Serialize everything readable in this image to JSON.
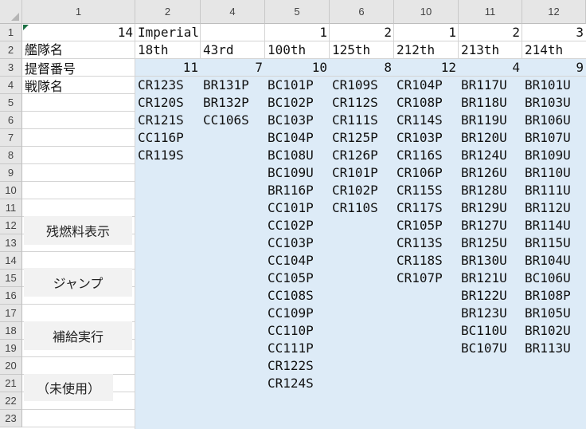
{
  "column_headers": [
    "1",
    "2",
    "4",
    "5",
    "6",
    "10",
    "11",
    "12"
  ],
  "row_headers": [
    "1",
    "2",
    "3",
    "4",
    "5",
    "6",
    "7",
    "8",
    "9",
    "10",
    "11",
    "12",
    "13",
    "14",
    "15",
    "16",
    "17",
    "18",
    "19",
    "20",
    "21",
    "22",
    "23"
  ],
  "row1": {
    "a": "14",
    "b": "Imperial",
    "c": "",
    "d": "1",
    "e": "2",
    "f": "1",
    "g": "2",
    "h": "3"
  },
  "row2": {
    "a": "艦隊名",
    "b": "18th",
    "c": "43rd",
    "d": "100th",
    "e": "125th",
    "f": "212th",
    "g": "213th",
    "h": "214th"
  },
  "row3": {
    "a": "提督番号",
    "b": "11",
    "c": "7",
    "d": "10",
    "e": "8",
    "f": "12",
    "g": "4",
    "h": "9"
  },
  "row4_label": "戦隊名",
  "ships": {
    "col2": [
      "CR123S",
      "CR120S",
      "CR121S",
      "CC116P",
      "CR119S"
    ],
    "col4": [
      "BR131P",
      "BR132P",
      "CC106S"
    ],
    "col5": [
      "BC101P",
      "BC102P",
      "BC103P",
      "BC104P",
      "BC108U",
      "BC109U",
      "BR116P",
      "CC101P",
      "CC102P",
      "CC103P",
      "CC104P",
      "CC105P",
      "CC108S",
      "CC109P",
      "CC110P",
      "CC111P",
      "CR122S",
      "CR124S"
    ],
    "col6": [
      "CR109S",
      "CR112S",
      "CR111S",
      "CR125P",
      "CR126P",
      "CR101P",
      "CR102P",
      "CR110S"
    ],
    "col10": [
      "CR104P",
      "CR108P",
      "CR114S",
      "CR103P",
      "CR116S",
      "CR106P",
      "CR115S",
      "CR117S",
      "CR105P",
      "CR113S",
      "CR118S",
      "CR107P"
    ],
    "col11": [
      "BR117U",
      "BR118U",
      "BR119U",
      "BR120U",
      "BR124U",
      "BR126U",
      "BR128U",
      "BR129U",
      "BR127U",
      "BR125U",
      "BR130U",
      "BR121U",
      "BR122U",
      "BR123U",
      "BC110U",
      "BC107U"
    ],
    "col12": [
      "BR101U",
      "BR103U",
      "BR106U",
      "BR107U",
      "BR109U",
      "BR110U",
      "BR111U",
      "BR112U",
      "BR114U",
      "BR115U",
      "BR104U",
      "BC106U",
      "BR108P",
      "BR105U",
      "BR102U",
      "BR113U"
    ]
  },
  "buttons": {
    "fuel": "残燃料表示",
    "jump": "ジャンプ",
    "resupply": "補給実行",
    "unused": "（未使用）"
  }
}
